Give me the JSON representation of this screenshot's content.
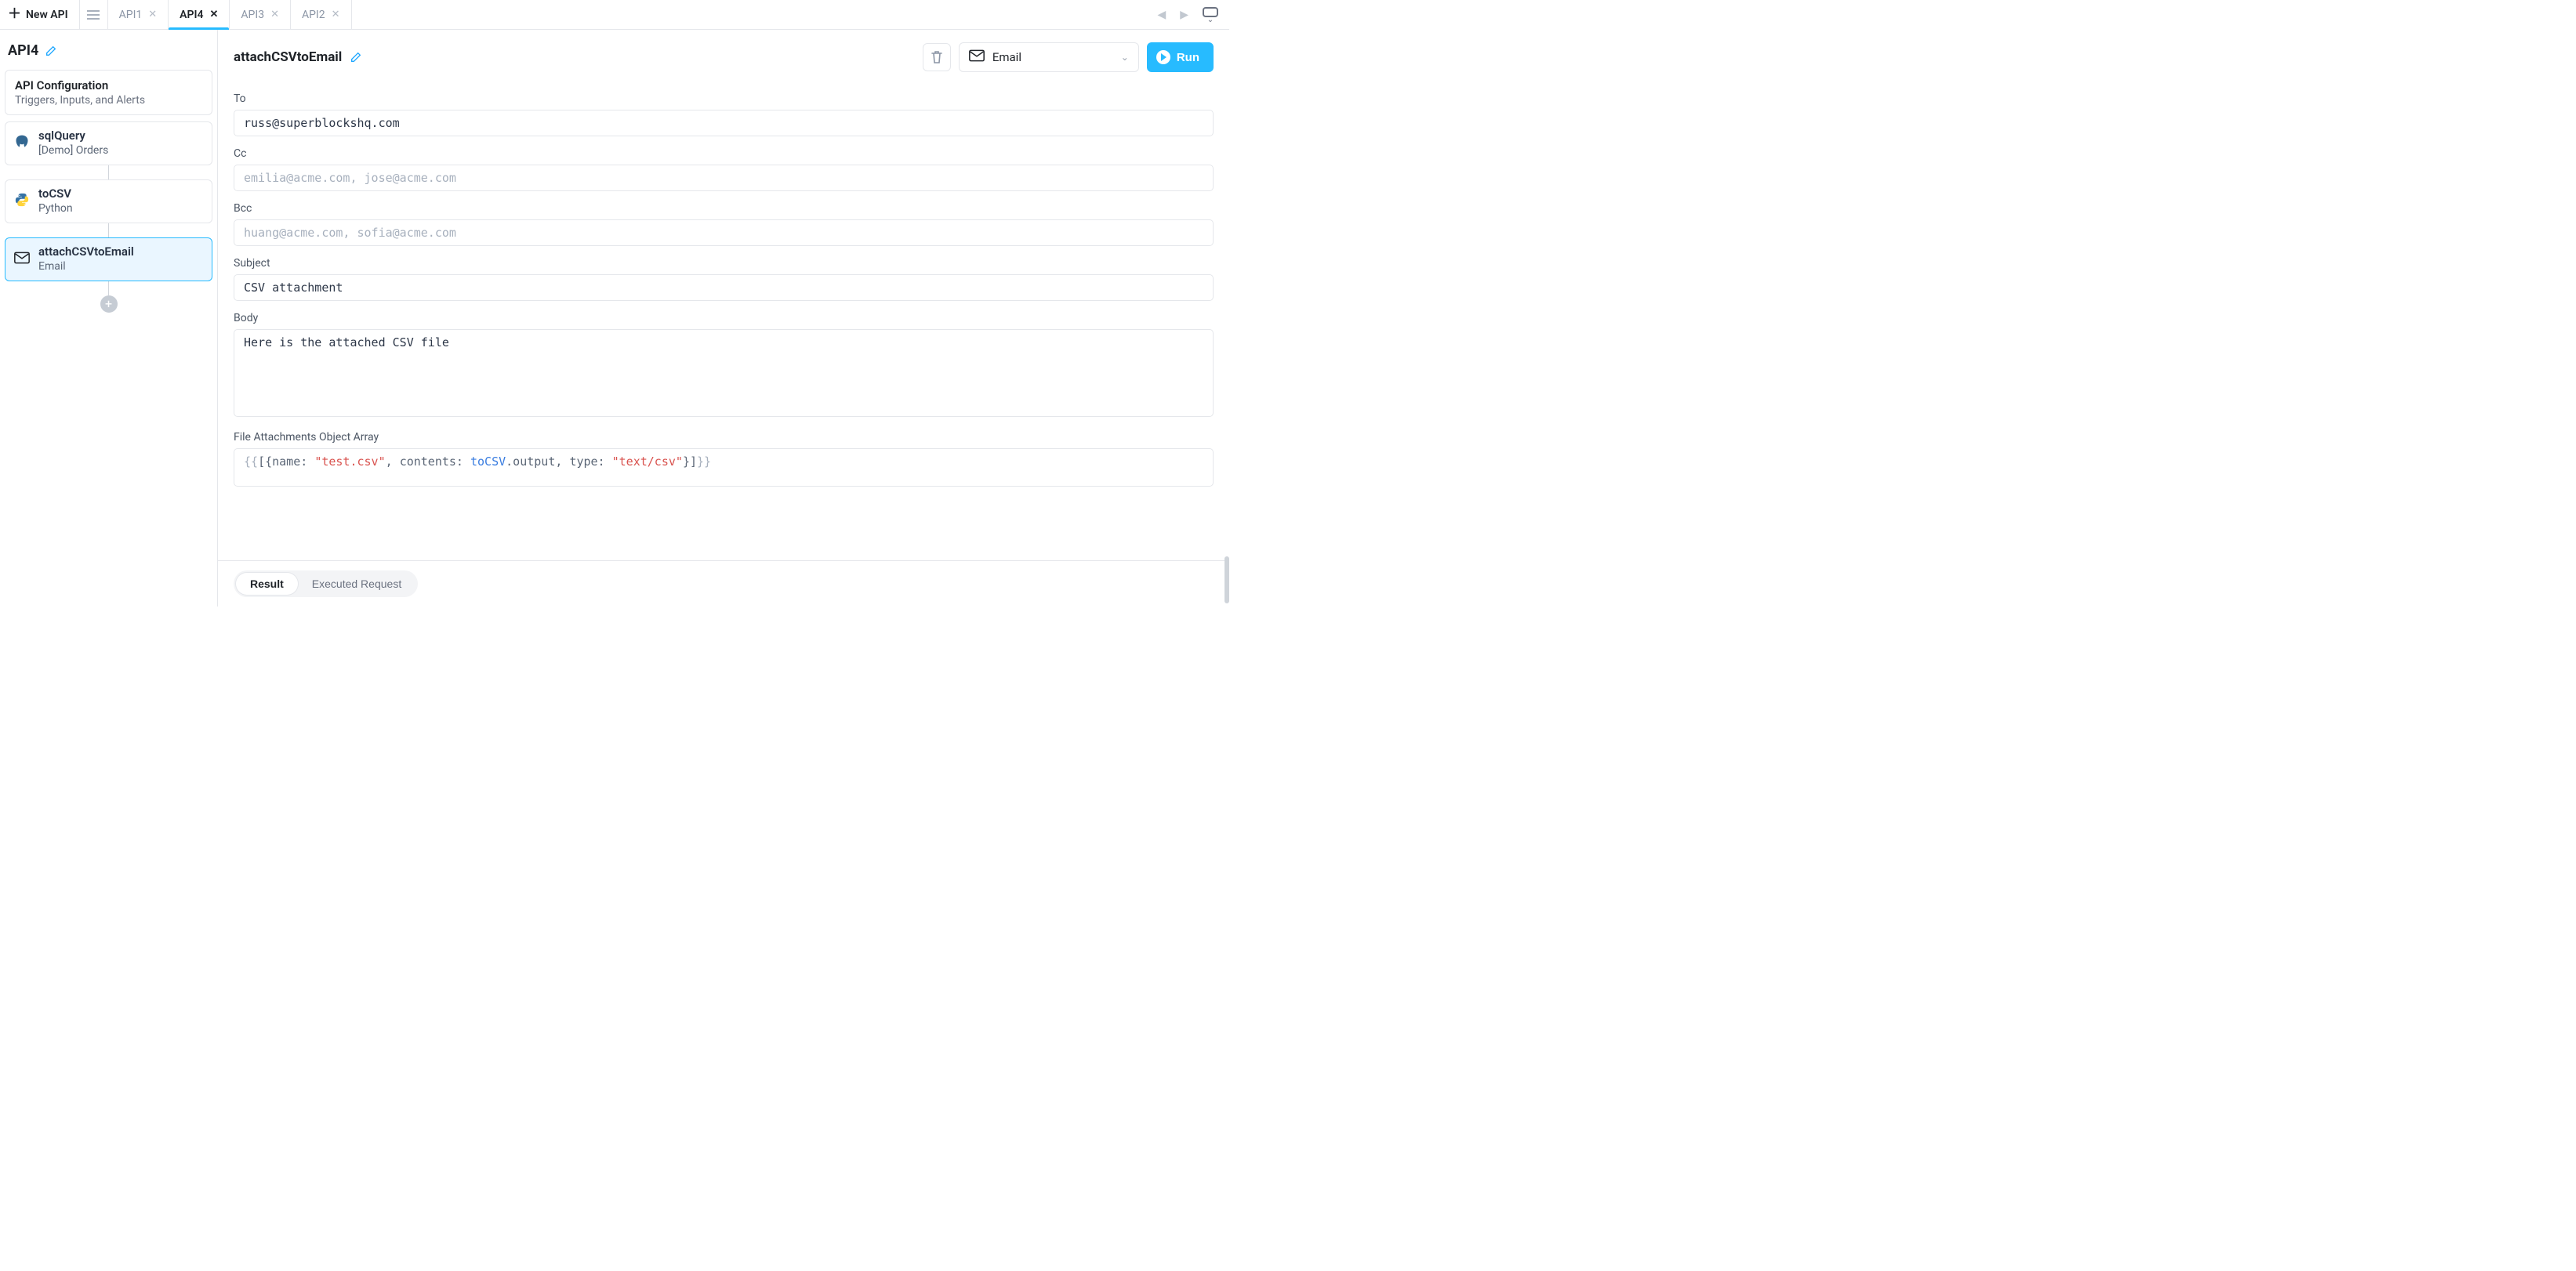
{
  "tabstrip": {
    "newApiLabel": "New API",
    "tabs": [
      {
        "label": "API1",
        "active": false
      },
      {
        "label": "API4",
        "active": true
      },
      {
        "label": "API3",
        "active": false
      },
      {
        "label": "API2",
        "active": false
      }
    ]
  },
  "sidebar": {
    "apiName": "API4",
    "configCard": {
      "title": "API Configuration",
      "subtitle": "Triggers, Inputs, and Alerts"
    },
    "steps": [
      {
        "id": "sqlQuery",
        "title": "sqlQuery",
        "subtitle": "[Demo] Orders",
        "icon": "postgres",
        "selected": false
      },
      {
        "id": "toCSV",
        "title": "toCSV",
        "subtitle": "Python",
        "icon": "python",
        "selected": false
      },
      {
        "id": "attachCSVtoEmail",
        "title": "attachCSVtoEmail",
        "subtitle": "Email",
        "icon": "mail",
        "selected": true
      }
    ]
  },
  "editor": {
    "title": "attachCSVtoEmail",
    "integrationSelect": "Email",
    "runLabel": "Run",
    "fields": {
      "to": {
        "label": "To",
        "value": "russ@superblockshq.com",
        "placeholder": ""
      },
      "cc": {
        "label": "Cc",
        "value": "",
        "placeholder": "emilia@acme.com, jose@acme.com"
      },
      "bcc": {
        "label": "Bcc",
        "value": "",
        "placeholder": "huang@acme.com, sofia@acme.com"
      },
      "subject": {
        "label": "Subject",
        "value": "CSV attachment",
        "placeholder": ""
      },
      "body": {
        "label": "Body",
        "value": "Here is the attached CSV file",
        "placeholder": ""
      },
      "fileAttach": {
        "label": "File Attachments Object Array"
      }
    },
    "fileAttachCode": {
      "openDelim": "{{",
      "bracketOpen": "[{",
      "nameKey": "name: ",
      "nameVal": "\"test.csv\"",
      "sep1": ", ",
      "contentsKey": "contents: ",
      "contentsIdent": "toCSV",
      "contentsTail": ".output, ",
      "typeKey": "type: ",
      "typeVal": "\"text/csv\"",
      "bracketClose": "}]",
      "closeDelim": "}}"
    }
  },
  "bottombar": {
    "resultLabel": "Result",
    "executedLabel": "Executed Request"
  }
}
